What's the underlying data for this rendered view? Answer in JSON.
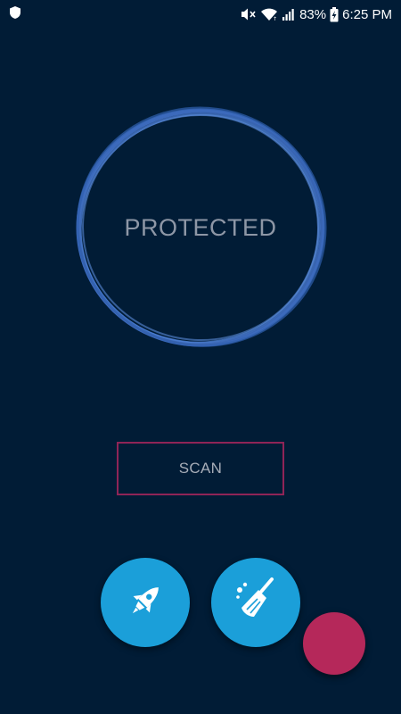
{
  "status_bar": {
    "battery_percent": "83%",
    "time": "6:25 PM",
    "icons": [
      "shield-icon",
      "mute-icon",
      "wifi-icon",
      "signal-icon",
      "battery-charging-icon"
    ]
  },
  "main": {
    "status_text": "PROTECTED",
    "scan_label": "SCAN"
  },
  "actions": {
    "buttons": [
      "rocket-icon",
      "broom-icon"
    ]
  },
  "colors": {
    "background": "#011c36",
    "ring": "#3f6fc4",
    "scan_border": "#8f2457",
    "action_button": "#1b9fd9",
    "fab": "#b5285a"
  }
}
